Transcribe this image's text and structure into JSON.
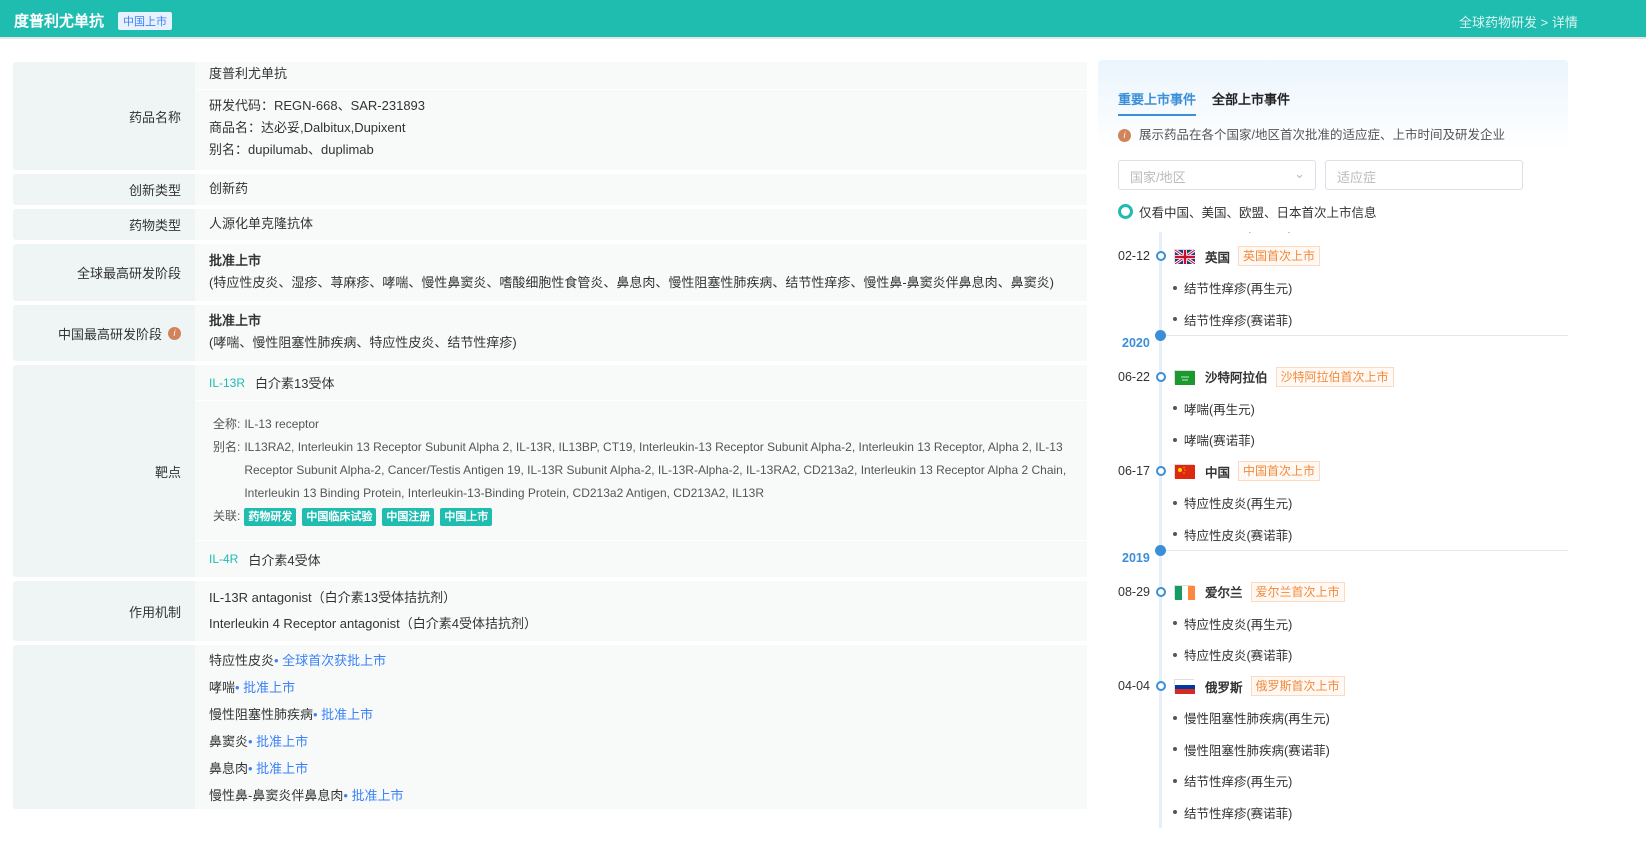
{
  "header": {
    "title": "度普利尤单抗",
    "badge": "中国上市",
    "breadcrumb": "全球药物研发 > 详情"
  },
  "table": {
    "drug_name": {
      "label": "药品名称",
      "name": "度普利尤单抗",
      "code": "研发代码：REGN-668、SAR-231893",
      "trade": "商品名：达必妥,Dalbitux,Dupixent",
      "alias": "别名：dupilumab、duplimab"
    },
    "innovation": {
      "label": "创新类型",
      "value": "创新药"
    },
    "drug_type": {
      "label": "药物类型",
      "value": "人源化单克隆抗体"
    },
    "global_stage": {
      "label": "全球最高研发阶段",
      "value": "批准上市",
      "detail": "(特应性皮炎、湿疹、荨麻疹、哮喘、慢性鼻窦炎、嗜酸细胞性食管炎、鼻息肉、慢性阻塞性肺疾病、结节性痒疹、慢性鼻-鼻窦炎伴鼻息肉、鼻窦炎)"
    },
    "china_stage": {
      "label": "中国最高研发阶段",
      "value": "批准上市",
      "detail": "(哮喘、慢性阻塞性肺疾病、特应性皮炎、结节性痒疹)"
    },
    "target": {
      "label": "靶点",
      "t1_code": "IL-13R",
      "t1_name": "白介素13受体",
      "full_key": "全称:",
      "full": "IL-13 receptor",
      "alias_key": "别名:",
      "alias": "IL13RA2, Interleukin 13 Receptor Subunit Alpha 2, IL-13R, IL13BP, CT19, Interleukin-13 Receptor Subunit Alpha-2, Interleukin 13 Receptor, Alpha 2, IL-13 Receptor Subunit Alpha-2, Cancer/Testis Antigen 19, IL-13R Subunit Alpha-2, IL-13R-Alpha-2, IL-13RA2, CD213a2, Interleukin 13 Receptor Alpha 2 Chain, Interleukin 13 Binding Protein, Interleukin-13-Binding Protein, CD213a2 Antigen, CD213A2, IL13R",
      "rel_key": "关联:",
      "tags": [
        "药物研发",
        "中国临床试验",
        "中国注册",
        "中国上市"
      ],
      "t2_code": "IL-4R",
      "t2_name": "白介素4受体"
    },
    "mechanism": {
      "label": "作用机制",
      "items": [
        "IL-13R antagonist（白介素13受体拮抗剂）",
        "Interleukin 4 Receptor antagonist（白介素4受体拮抗剂）"
      ]
    },
    "indications": [
      {
        "name": "特应性皮炎",
        "status": "• 全球首次获批上市"
      },
      {
        "name": "哮喘",
        "status": "• 批准上市"
      },
      {
        "name": "慢性阻塞性肺疾病",
        "status": "• 批准上市"
      },
      {
        "name": "鼻窦炎",
        "status": "• 批准上市"
      },
      {
        "name": "鼻息肉",
        "status": "• 批准上市"
      },
      {
        "name": "慢性鼻-鼻窦炎伴鼻息肉",
        "status": "• 批准上市"
      }
    ]
  },
  "panel": {
    "tabs": [
      "重要上市事件",
      "全部上市事件"
    ],
    "hint": "展示药品在各个国家/地区首次批准的适应症、上市时间及研发企业",
    "country_placeholder": "国家/地区",
    "indication_placeholder": "适应症",
    "toggle_label": "仅看中国、美国、欧盟、日本首次上市信息",
    "timeline": [
      {
        "type": "item",
        "text": "结节性痒疹(赛诺菲)"
      },
      {
        "type": "event",
        "date": "02-12",
        "flag": "uk",
        "country": "英国",
        "tag": "英国首次上市"
      },
      {
        "type": "item",
        "text": "结节性痒疹(再生元)"
      },
      {
        "type": "item",
        "text": "结节性痒疹(赛诺菲)"
      },
      {
        "type": "year",
        "year": "2020"
      },
      {
        "type": "event",
        "date": "06-22",
        "flag": "sa",
        "country": "沙特阿拉伯",
        "tag": "沙特阿拉伯首次上市"
      },
      {
        "type": "item",
        "text": "哮喘(再生元)"
      },
      {
        "type": "item",
        "text": "哮喘(赛诺菲)"
      },
      {
        "type": "event",
        "date": "06-17",
        "flag": "cn",
        "country": "中国",
        "tag": "中国首次上市"
      },
      {
        "type": "item",
        "text": "特应性皮炎(再生元)"
      },
      {
        "type": "item",
        "text": "特应性皮炎(赛诺菲)"
      },
      {
        "type": "year",
        "year": "2019"
      },
      {
        "type": "event",
        "date": "08-29",
        "flag": "ie",
        "country": "爱尔兰",
        "tag": "爱尔兰首次上市"
      },
      {
        "type": "item",
        "text": "特应性皮炎(再生元)"
      },
      {
        "type": "item",
        "text": "特应性皮炎(赛诺菲)"
      },
      {
        "type": "event",
        "date": "04-04",
        "flag": "ru",
        "country": "俄罗斯",
        "tag": "俄罗斯首次上市"
      },
      {
        "type": "item",
        "text": "慢性阻塞性肺疾病(再生元)"
      },
      {
        "type": "item",
        "text": "慢性阻塞性肺疾病(赛诺菲)"
      },
      {
        "type": "item",
        "text": "结节性痒疹(再生元)"
      },
      {
        "type": "item",
        "text": "结节性痒疹(赛诺菲)"
      }
    ]
  },
  "colors": {
    "brand": "#1fbcb0",
    "accent": "#3b8fd8",
    "tag_orange": "#f08a3c"
  }
}
